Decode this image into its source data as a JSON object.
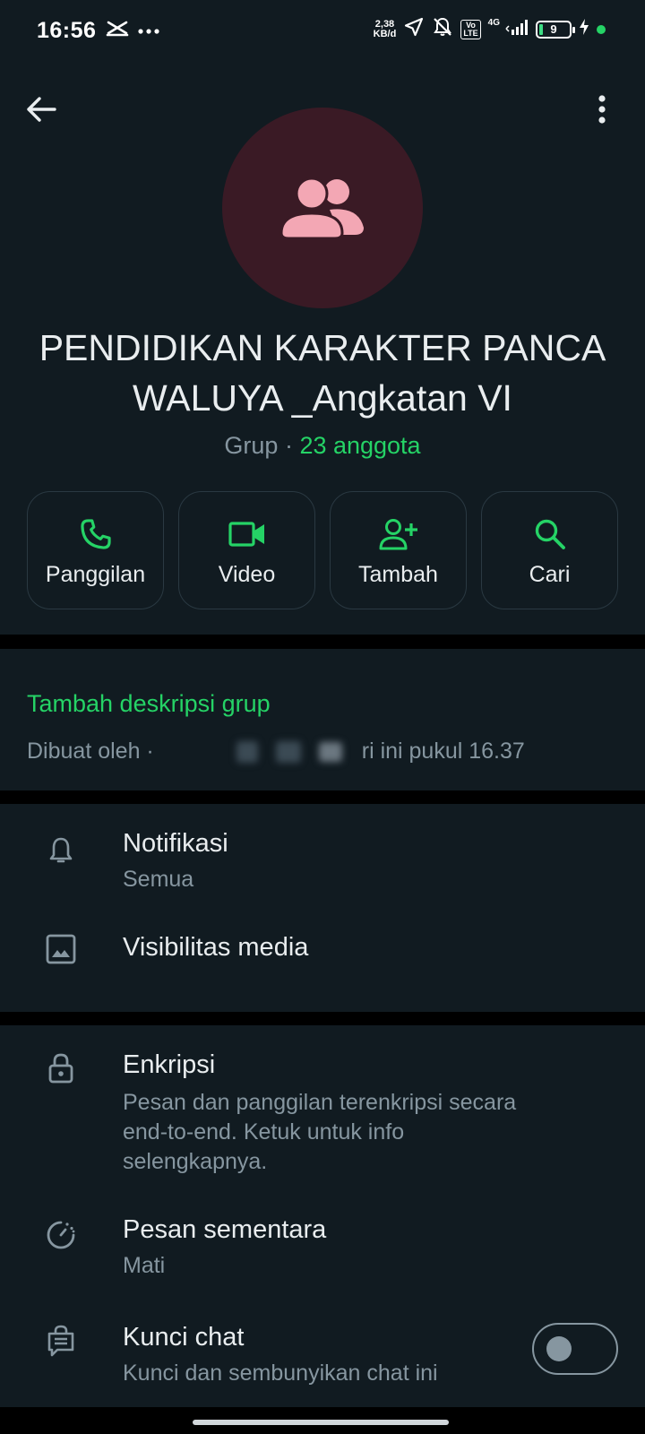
{
  "status_bar": {
    "time": "16:56",
    "net_speed_value": "2,38",
    "net_speed_unit": "KB/d",
    "volte_top": "Vo",
    "volte_bottom": "LTE",
    "network": "4G",
    "battery_level": "9"
  },
  "group": {
    "name": "PENDIDIKAN KARAKTER PANCA WALUYA _Angkatan VI",
    "type_label": "Grup",
    "separator": " · ",
    "members_label": "23 anggota"
  },
  "actions": [
    {
      "label": "Panggilan",
      "icon": "phone-icon"
    },
    {
      "label": "Video",
      "icon": "video-icon"
    },
    {
      "label": "Tambah",
      "icon": "add-person-icon"
    },
    {
      "label": "Cari",
      "icon": "search-icon"
    }
  ],
  "description": {
    "add_link": "Tambah deskripsi grup",
    "created_prefix": "Dibuat oleh ·",
    "created_suffix": "ri ini pukul 16.37"
  },
  "settings": {
    "notifications": {
      "title": "Notifikasi",
      "subtitle": "Semua"
    },
    "media_visibility": {
      "title": "Visibilitas media"
    },
    "encryption": {
      "title": "Enkripsi",
      "subtitle": "Pesan dan panggilan terenkripsi secara end-to-end. Ketuk untuk info selengkapnya."
    },
    "disappearing": {
      "title": "Pesan sementara",
      "subtitle": "Mati"
    },
    "chat_lock": {
      "title": "Kunci chat",
      "subtitle": "Kunci dan sembunyikan chat ini",
      "enabled": false
    }
  },
  "colors": {
    "accent": "#25d366",
    "background": "#111b21",
    "avatar_bg": "#3a1a25",
    "avatar_icon": "#f3a7b4"
  }
}
